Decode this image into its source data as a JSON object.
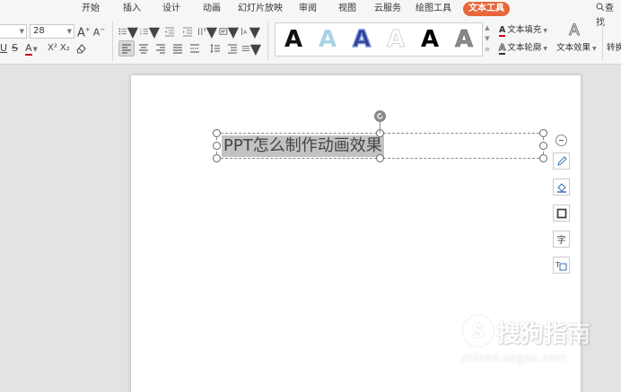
{
  "menu": {
    "tabs": [
      "开始",
      "插入",
      "设计",
      "动画",
      "幻灯片放映",
      "审阅",
      "视图",
      "云服务",
      "绘图工具",
      "文本工具"
    ],
    "active_tab": "文本工具",
    "search_label": "查找"
  },
  "font": {
    "size": "28",
    "grow_label": "A",
    "shrink_label": "A",
    "underline": "U",
    "strike": "S",
    "color_label": "A",
    "superscript": "X²",
    "subscript": "X₂"
  },
  "art_gallery": {
    "glyph": "A",
    "styles": [
      "black-solid",
      "light-blue",
      "blue-outline",
      "white-outline",
      "black-bold",
      "gray-gradient"
    ]
  },
  "right_tools": {
    "text_fill": "文本填充",
    "text_outline": "文本轮廓",
    "text_effect": "文本效果",
    "convert": "转换"
  },
  "slide": {
    "text": "PPT怎么制作动画效果"
  },
  "colors": {
    "accent": "#e8663a",
    "font_color_bar": "#d0021b"
  },
  "watermark": {
    "text": "搜狗指南",
    "url": "zhinan.sogou.com",
    "logo": "S"
  }
}
